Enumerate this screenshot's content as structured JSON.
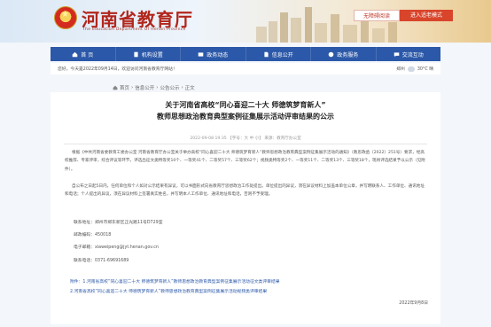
{
  "header": {
    "site_title": "河南省教育厅",
    "site_subtitle": "The Education Department Of Henan Province",
    "accessibility_label": "无障碍阅读",
    "elder_mode_label": "进入适老模式"
  },
  "nav": [
    {
      "label": "首 页",
      "icon": "home-icon"
    },
    {
      "label": "机构设置",
      "icon": "building-icon"
    },
    {
      "label": "政务动态",
      "icon": "news-icon"
    },
    {
      "label": "信息公开",
      "icon": "document-icon"
    },
    {
      "label": "政务服务",
      "icon": "service-icon"
    },
    {
      "label": "交流互动",
      "icon": "chat-icon"
    }
  ],
  "infobar": {
    "greeting": "您好，今天是2022年09月14日，欢迎访问河南省教育厅网站！",
    "city": "郑州",
    "temperature": "30°C 晴"
  },
  "breadcrumb": {
    "home": "首页",
    "sep1": "›",
    "level1": "信息公开",
    "sep2": "›",
    "level2": "公告公示",
    "sep3": "›",
    "level3": "正文"
  },
  "article": {
    "title_line1": "关于河南省高校“同心喜迎二十大 师德筑梦育新人”",
    "title_line2": "教师思想政治教育典型案例征集展示活动评审结果的公示",
    "meta": "2022-09-08 19:35  【字号：大 中 小】  来源：教育厅办公室",
    "paragraph1": "根据《中共河南省委教育工委办公室 河南省教育厅办公室关于举办高校“同心喜迎二十大 师德筑梦育新人”教师思想政治教育典型案例征集展示活动的通知》（教思政函〔2022〕251号）要求，经高校推荐、专家评审，综合评议等环节，评选出征文类特等奖10个、一等奖41个、二等奖57个、三等奖62个；视频类特等奖2个、一等奖11个、二等奖13个、三等奖18个，现将评选结果予以公示（见附件）。",
    "paragraph2": "自公布之日起5日内，任何单位和个人如对公示结果有异议，可以书面形式向省教育厅思想政治工作处提出。单位提出的异议，须在异议材料上加盖本单位公章，并写明联系人、工作单位、通讯地址和电话；个人提出的异议，须在异议材料上签署真实姓名，并写明本人工作单位、通讯地址和电话，否则不予受理。",
    "contact_address": "联系地址：郑州市郑东新区正光路11号D729室",
    "contact_zip": "邮政编码：450018",
    "contact_email": "电子邮箱：xiaweipeng@jyt.henan.gov.cn",
    "contact_phone": "联系电话：0371-69691689",
    "attachment1": "附件：1.河南省高校“同心喜迎二十大 师德筑梦育新人”教师思想政治教育典型案例征集展示活动征文类评审结果",
    "attachment2": "2.河南省高校“同心喜迎二十大 师德筑梦育新人”教师思想政治教育典型案例征集展示活动视频类评审结果",
    "date": "2022年9月8日"
  },
  "colors": {
    "brand_red": "#b2261c",
    "nav_blue": "#2b58a8",
    "link_blue": "#2b58a8"
  }
}
